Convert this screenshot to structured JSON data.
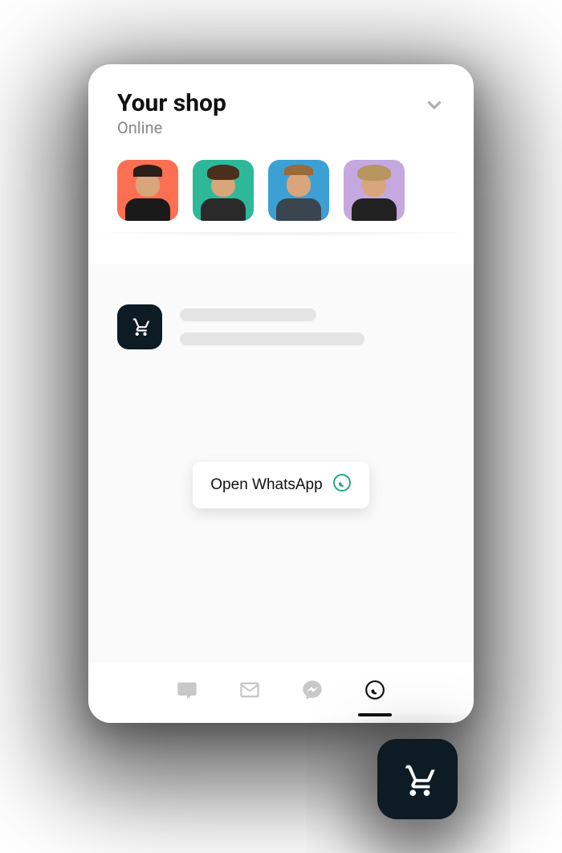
{
  "header": {
    "title": "Your shop",
    "status": "Online"
  },
  "avatars": [
    {
      "bg": "#fc6f52"
    },
    {
      "bg": "#2db89a"
    },
    {
      "bg": "#3ca0d4"
    },
    {
      "bg": "#c5a8e0"
    }
  ],
  "action": {
    "open_label": "Open WhatsApp"
  },
  "icons": {
    "chevron": "chevron-down-icon",
    "cart": "cart-icon",
    "chat": "chat-icon",
    "email": "email-icon",
    "messenger": "messenger-icon",
    "whatsapp": "whatsapp-icon"
  },
  "colors": {
    "whatsapp": "#25a87f",
    "inactive": "#c8c8c8",
    "active": "#111111",
    "card_bg": "#ffffff",
    "fab_bg": "#0d1b24"
  },
  "tabs": [
    {
      "name": "chat",
      "active": false
    },
    {
      "name": "email",
      "active": false
    },
    {
      "name": "messenger",
      "active": false
    },
    {
      "name": "whatsapp",
      "active": true
    }
  ]
}
